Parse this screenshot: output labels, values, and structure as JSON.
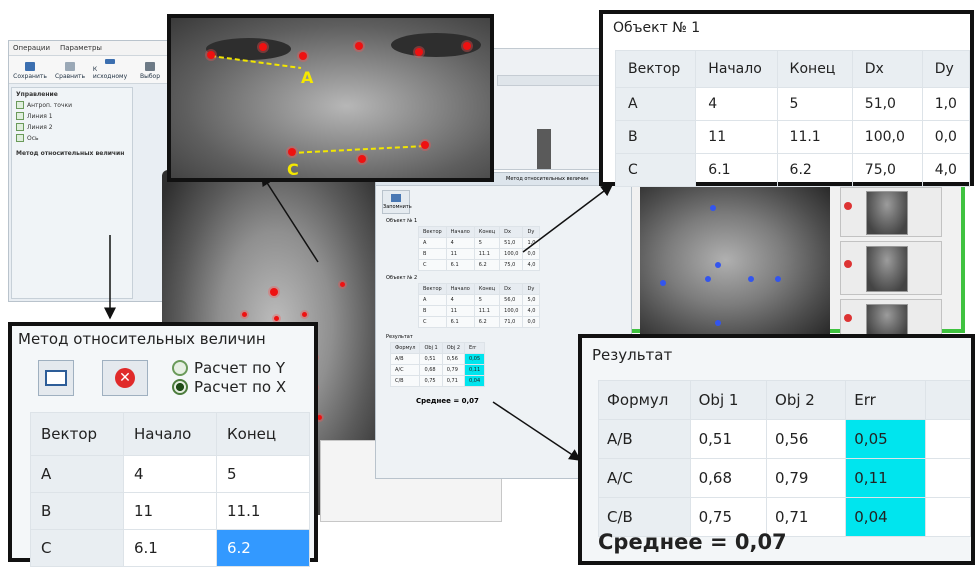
{
  "app": {
    "menu": [
      "Операции",
      "Параметры"
    ],
    "toolbar": [
      "Сохранить",
      "Сравнить",
      "К исходному",
      "Выбор"
    ],
    "left_panel": {
      "section_title": "Управление",
      "checkboxes": [
        "Антроп. точки",
        "Линия 1",
        "Линия 2",
        "Ось"
      ],
      "method_title": "Метод относительных величин"
    }
  },
  "zoom_face": {
    "labels": [
      "A",
      "C"
    ]
  },
  "object1": {
    "title": "Объект № 1",
    "columns": [
      "Вектор",
      "Начало",
      "Конец",
      "Dx",
      "Dy"
    ],
    "rows": [
      [
        "A",
        "4",
        "5",
        "51,0",
        "1,0"
      ],
      [
        "B",
        "11",
        "11.1",
        "100,0",
        "0,0"
      ],
      [
        "C",
        "6.1",
        "6.2",
        "75,0",
        "4,0"
      ]
    ]
  },
  "method": {
    "title": "Метод относительных величин",
    "radio_y": "Расчет по Y",
    "radio_x": "Расчет по X",
    "columns": [
      "Вектор",
      "Начало",
      "Конец"
    ],
    "rows": [
      [
        "A",
        "4",
        "5"
      ],
      [
        "B",
        "11",
        "11.1"
      ],
      [
        "C",
        "6.1",
        "6.2"
      ]
    ]
  },
  "result": {
    "title": "Результат",
    "columns": [
      "Формул",
      "Obj 1",
      "Obj 2",
      "Err"
    ],
    "rows": [
      [
        "A/B",
        "0,51",
        "0,56",
        "0,05"
      ],
      [
        "A/C",
        "0,68",
        "0,79",
        "0,11"
      ],
      [
        "C/B",
        "0,75",
        "0,71",
        "0,04"
      ]
    ],
    "average": "Среднее = 0,07"
  },
  "mid_window": {
    "save_label": "Запомнить",
    "obj1_title": "Объект № 1",
    "obj2_title": "Объект № 2",
    "columns": [
      "Вектор",
      "Начало",
      "Конец",
      "Dx",
      "Dy"
    ],
    "obj1_rows": [
      [
        "A",
        "4",
        "5",
        "51,0",
        "1,0"
      ],
      [
        "B",
        "11",
        "11.1",
        "100,0",
        "0,0"
      ],
      [
        "C",
        "6.1",
        "6.2",
        "75,0",
        "4,0"
      ]
    ],
    "obj2_rows": [
      [
        "A",
        "4",
        "5",
        "56,0",
        "5,0"
      ],
      [
        "B",
        "11",
        "11.1",
        "100,0",
        "4,0"
      ],
      [
        "C",
        "6.1",
        "6.2",
        "71,0",
        "0,0"
      ]
    ],
    "result_title": "Результат",
    "result_columns": [
      "Формул",
      "Obj 1",
      "Obj 2",
      "Err"
    ],
    "result_rows": [
      [
        "A/B",
        "0,51",
        "0,56",
        "0,05"
      ],
      [
        "A/C",
        "0,68",
        "0,79",
        "0,11"
      ],
      [
        "C/B",
        "0,75",
        "0,71",
        "0,04"
      ]
    ],
    "average": "Среднее = 0,07",
    "panel_title": "Метод относительных величин"
  },
  "colors": {
    "highlight_cyan": "#00e5ee",
    "selected_blue": "#3399ff",
    "landmark_red": "#e11111",
    "landmark_blue": "#3355ee",
    "frame_green": "#3fc23f"
  }
}
